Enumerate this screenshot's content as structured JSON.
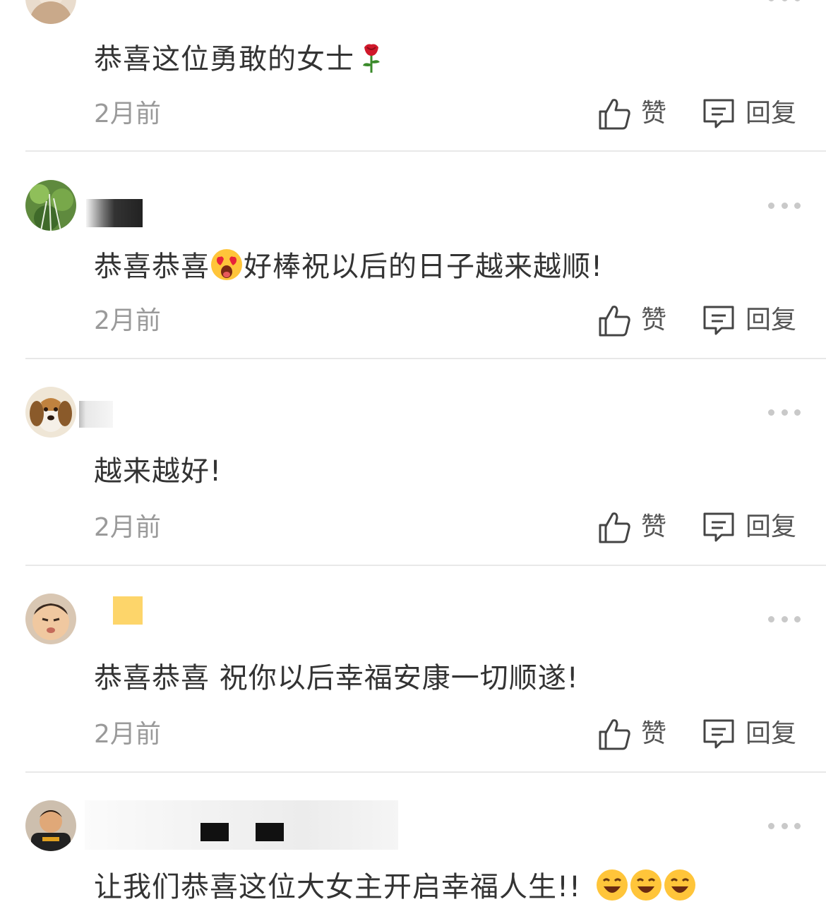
{
  "like_label": "赞",
  "reply_label": "回复",
  "comments": [
    {
      "text": "恭喜这位勇敢的女士",
      "emoji_after": "rose-icon",
      "time": "2月前"
    },
    {
      "text_before": "恭喜恭喜",
      "emoji_mid": "heart-eyes-emoji",
      "text_after": "好棒祝以后的日子越来越顺!",
      "time": "2月前"
    },
    {
      "text": "越来越好!",
      "time": "2月前"
    },
    {
      "text": "恭喜恭喜 祝你以后幸福安康一切顺遂!",
      "time": "2月前"
    },
    {
      "text": "让我们恭喜这位大女主开启幸福人生!!",
      "emoji_after": "laughing-emoji",
      "time": ""
    }
  ],
  "colors": {
    "text": "#333333",
    "muted": "#9a9a9a",
    "divider": "#e8e8e8",
    "dots": "#c9c9c9"
  }
}
